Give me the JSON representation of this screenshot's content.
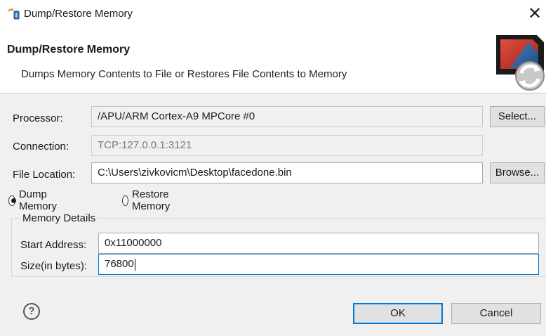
{
  "window": {
    "title": "Dump/Restore Memory",
    "close_glyph": "✕"
  },
  "banner": {
    "title": "Dump/Restore Memory",
    "description": "Dumps Memory Contents to File or Restores File Contents to Memory",
    "icon": "memory-dump-restore-icon"
  },
  "form": {
    "processor": {
      "label": "Processor:",
      "value": "/APU/ARM Cortex-A9 MPCore #0",
      "button": "Select..."
    },
    "connection": {
      "label": "Connection:",
      "value": "TCP:127.0.0.1:3121"
    },
    "file_location": {
      "label": "File Location:",
      "value": "C:\\Users\\zivkovicm\\Desktop\\facedone.bin",
      "button": "Browse..."
    },
    "mode": {
      "options": [
        {
          "label": "Dump Memory",
          "checked": true
        },
        {
          "label": "Restore Memory",
          "checked": false
        }
      ]
    },
    "memory_details": {
      "legend": "Memory Details",
      "start_address": {
        "label": "Start Address:",
        "value": "0x11000000"
      },
      "size": {
        "label": "Size(in bytes):",
        "value": "76800"
      }
    }
  },
  "footer": {
    "help_glyph": "?",
    "ok": "OK",
    "cancel": "Cancel"
  },
  "colors": {
    "dialog_bg": "#f0f0f0",
    "focus_accent": "#0078d7"
  }
}
